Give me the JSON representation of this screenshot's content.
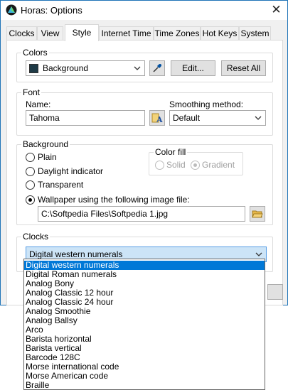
{
  "window": {
    "title": "Horas: Options",
    "close_glyph": "✕"
  },
  "tabs": [
    {
      "label": "Clocks"
    },
    {
      "label": "View"
    },
    {
      "label": "Style"
    },
    {
      "label": "Internet Time"
    },
    {
      "label": "Time Zones"
    },
    {
      "label": "Hot Keys"
    },
    {
      "label": "System"
    }
  ],
  "colors": {
    "group_label": "Colors",
    "selected": "Background",
    "swatch_color": "#1e3a46",
    "edit_button": "Edit...",
    "reset_button": "Reset All"
  },
  "font": {
    "group_label": "Font",
    "name_label": "Name:",
    "name_value": "Tahoma",
    "smoothing_label": "Smoothing method:",
    "smoothing_value": "Default"
  },
  "background": {
    "group_label": "Background",
    "options": [
      "Plain",
      "Daylight indicator",
      "Transparent",
      "Wallpaper using the following image file:"
    ],
    "selected_index": 3,
    "color_fill_label": "Color fill",
    "fill_options": [
      "Solid",
      "Gradient"
    ],
    "fill_selected": "Gradient",
    "file_path": "C:\\Softpedia Files\\Softpedia 1.jpg"
  },
  "clocks": {
    "group_label": "Clocks",
    "selected": "Digital western numerals",
    "options": [
      "Digital western numerals",
      "Digital Roman numerals",
      "Analog Bony",
      "Analog Classic 12 hour",
      "Analog Classic 24 hour",
      "Analog Smoothie",
      "Analog Ballsy",
      "Arco",
      "Barista horizontal",
      "Barista vertical",
      "Barcode 128C",
      "Morse international code",
      "Morse American code",
      "Braille"
    ]
  }
}
